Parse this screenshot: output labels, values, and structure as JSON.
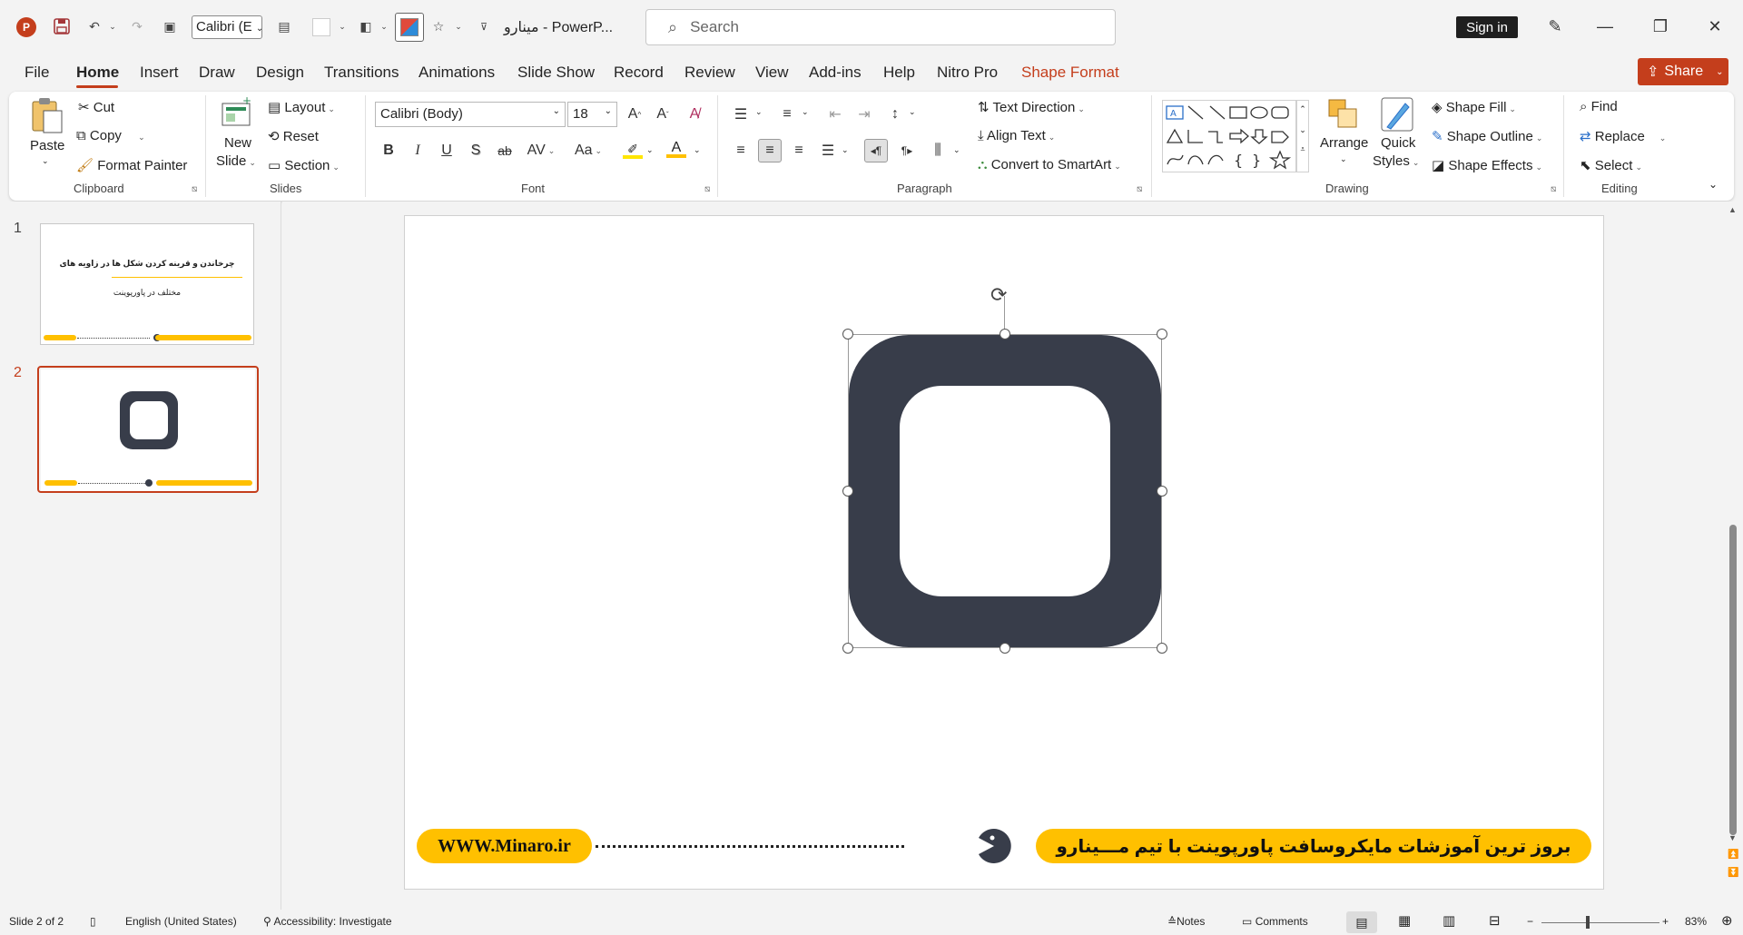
{
  "titlebar": {
    "app_name_short": "PowerP...",
    "doc_name": "مینارو",
    "separator": "-",
    "font_quick": "Calibri (E",
    "search_placeholder": "Search",
    "sign_in": "Sign in"
  },
  "menu": {
    "tabs": [
      "File",
      "Home",
      "Insert",
      "Draw",
      "Design",
      "Transitions",
      "Animations",
      "Slide Show",
      "Record",
      "Review",
      "View",
      "Add-ins",
      "Help",
      "Nitro Pro",
      "Shape Format"
    ],
    "share": "Share"
  },
  "ribbon": {
    "clipboard": {
      "paste": "Paste",
      "cut": "Cut",
      "copy": "Copy",
      "format_painter": "Format Painter",
      "label": "Clipboard"
    },
    "slides": {
      "new_slide": "New",
      "new_slide2": "Slide",
      "layout": "Layout",
      "reset": "Reset",
      "section": "Section",
      "label": "Slides"
    },
    "font": {
      "font_name": "Calibri (Body)",
      "font_size": "18",
      "bold": "B",
      "italic": "I",
      "underline": "U",
      "strike": "S",
      "shadow": "ab",
      "case": "Aa",
      "label": "Font"
    },
    "paragraph": {
      "text_direction": "Text Direction",
      "align_text": "Align Text",
      "convert_smartart": "Convert to SmartArt",
      "label": "Paragraph"
    },
    "drawing": {
      "arrange": "Arrange",
      "quick_styles": "Quick",
      "quick_styles2": "Styles",
      "shape_fill": "Shape Fill",
      "shape_outline": "Shape Outline",
      "shape_effects": "Shape Effects",
      "label": "Drawing"
    },
    "editing": {
      "find": "Find",
      "replace": "Replace",
      "select": "Select",
      "label": "Editing"
    }
  },
  "thumbs": [
    {
      "num": "1",
      "title_line1": "چرخاندن و قرینه کردن شکل ها در زاویه های",
      "title_line2": "مختلف در پاورپوینت"
    },
    {
      "num": "2"
    }
  ],
  "slide": {
    "website": "WWW.Minaro.ir",
    "banner": "بروز ترین آموزشات مایکروسافت پاورپوینت با تیم مـــینارو",
    "shape_color": "#383d4a",
    "accent": "#ffc000"
  },
  "status": {
    "slide_info": "Slide 2 of 2",
    "language": "English (United States)",
    "accessibility": "Accessibility: Investigate",
    "notes": "Notes",
    "comments": "Comments",
    "zoom": "83%"
  }
}
